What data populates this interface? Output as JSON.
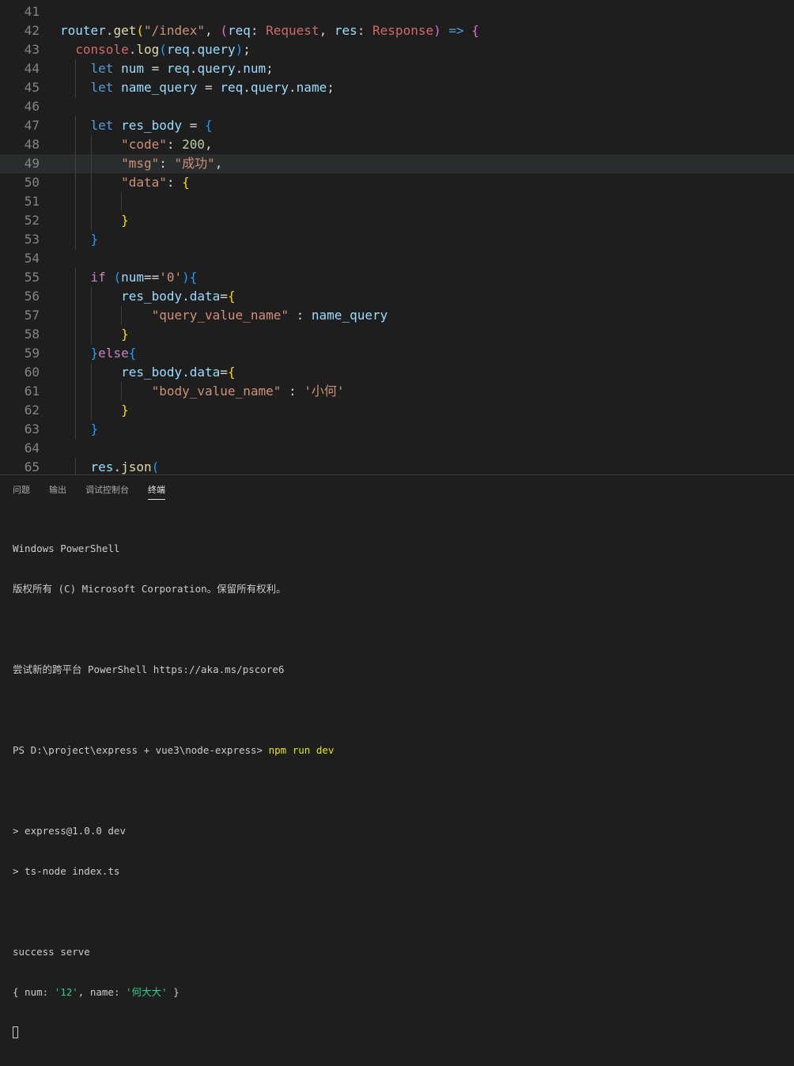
{
  "editor": {
    "line_numbers": [
      "41",
      "42",
      "43",
      "44",
      "45",
      "46",
      "47",
      "48",
      "49",
      "50",
      "51",
      "52",
      "53",
      "54",
      "55",
      "56",
      "57",
      "58",
      "59",
      "60",
      "61",
      "62",
      "63",
      "64",
      "65"
    ],
    "code_lines": [
      "",
      "router.get(\"/index\", (req: Request, res: Response) => {",
      "  console.log(req.query);",
      "    let num = req.query.num;",
      "    let name_query = req.query.name;",
      "",
      "    let res_body = {",
      "        \"code\": 200,",
      "        \"msg\": \"成功\",",
      "        \"data\": {",
      "",
      "        }",
      "    }",
      "",
      "    if (num=='0'){",
      "        res_body.data={",
      "            \"query_value_name\" : name_query",
      "        }",
      "    }else{",
      "        res_body.data={",
      "            \"body_value_name\" : '小何'",
      "        }",
      "    }",
      "",
      "    res.json("
    ],
    "highlighted_line": "49"
  },
  "panel": {
    "tabs": [
      {
        "label": "问题",
        "active": false
      },
      {
        "label": "输出",
        "active": false
      },
      {
        "label": "调试控制台",
        "active": false
      },
      {
        "label": "终端",
        "active": true
      }
    ]
  },
  "terminal": {
    "lines": [
      "Windows PowerShell",
      "版权所有 (C) Microsoft Corporation。保留所有权利。",
      "",
      "尝试新的跨平台 PowerShell https://aka.ms/pscore6",
      "",
      "PS D:\\project\\express + vue3\\node-express> npm run dev",
      "",
      "> express@1.0.0 dev",
      "> ts-node index.ts",
      "",
      "success serve",
      "{ num: '12', name: '何大大' }",
      ""
    ],
    "prompt_prefix": "PS D:\\project\\express + vue3\\node-express> ",
    "prompt_command": "npm run dev",
    "log_num_value": "'12'",
    "log_name_value": "'何大大'"
  },
  "colors": {
    "background": "#1e1e1e",
    "keyword": "#569cd6",
    "control": "#c586c0",
    "variable": "#9cdcfe",
    "function": "#dcdcaa",
    "string": "#ce9178",
    "number": "#b5cea8",
    "type_annotation": "#d16969",
    "bracket_1": "#ffd700",
    "bracket_2": "#da70d6",
    "bracket_3": "#179fff",
    "terminal_command": "#e5e510",
    "terminal_string": "#23d18b"
  }
}
